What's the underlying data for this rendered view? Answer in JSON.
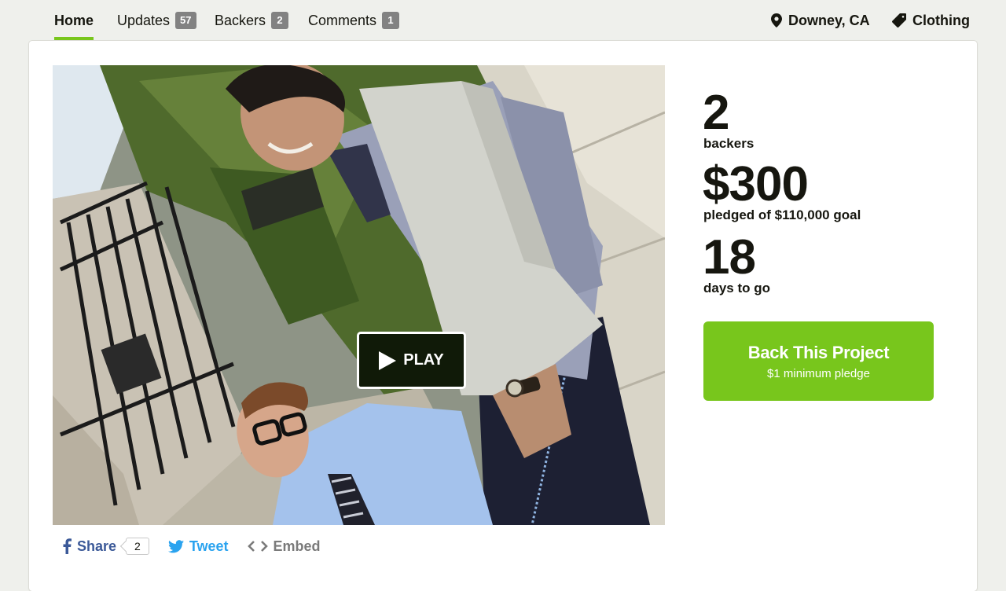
{
  "nav": {
    "tabs": [
      {
        "label": "Home",
        "count": null,
        "active": true
      },
      {
        "label": "Updates",
        "count": "57",
        "active": false
      },
      {
        "label": "Backers",
        "count": "2",
        "active": false
      },
      {
        "label": "Comments",
        "count": "1",
        "active": false
      }
    ],
    "location": {
      "label": "Downey, CA",
      "icon": "map-pin-icon"
    },
    "category": {
      "label": "Clothing",
      "icon": "tag-icon"
    }
  },
  "video": {
    "play_label": "PLAY"
  },
  "share": {
    "facebook_label": "Share",
    "facebook_count": "2",
    "twitter_label": "Tweet",
    "embed_label": "Embed"
  },
  "stats": {
    "backers_count": "2",
    "backers_label": "backers",
    "pledged_amount": "$300",
    "pledged_label": "pledged of $110,000 goal",
    "days_count": "18",
    "days_label": "days to go"
  },
  "cta": {
    "title": "Back This Project",
    "subtitle": "$1 minimum pledge"
  },
  "colors": {
    "accent": "#78c61c",
    "badge": "#828282",
    "facebook": "#3b5998",
    "twitter": "#2aa3ef",
    "text": "#16160f",
    "background": "#eff0ec"
  }
}
